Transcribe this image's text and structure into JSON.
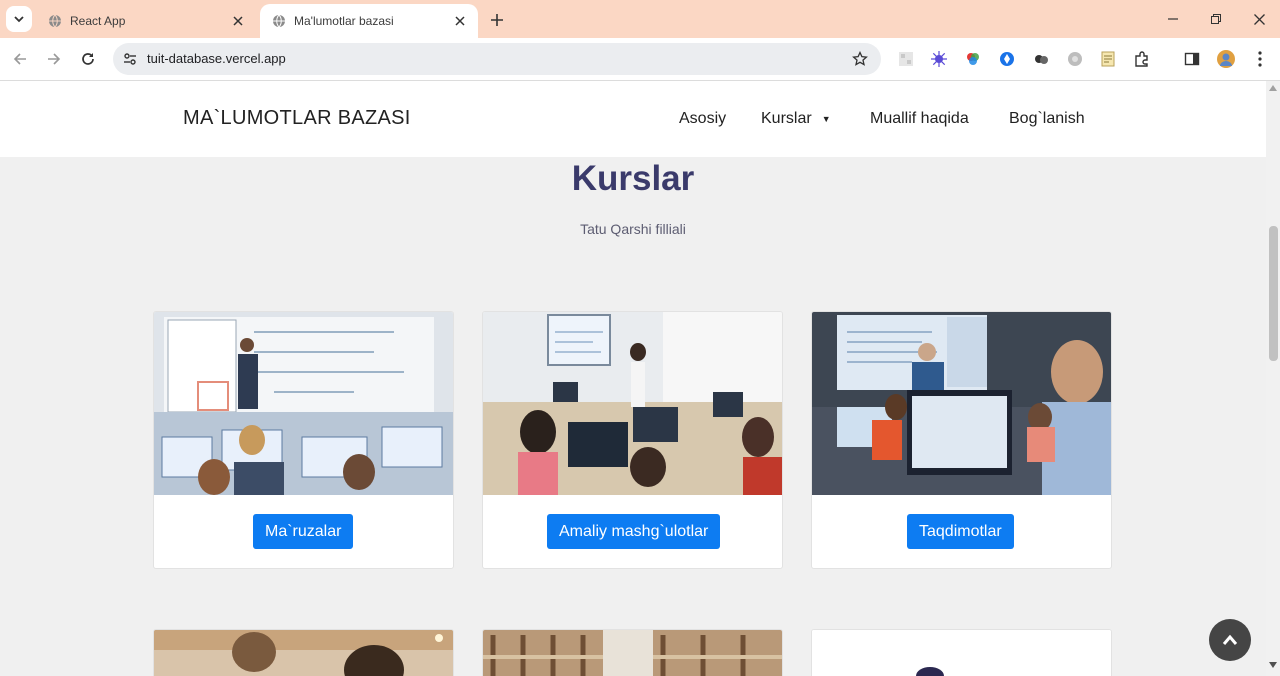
{
  "browser": {
    "tabs": [
      {
        "title": "React App",
        "active": false
      },
      {
        "title": "Ma'lumotlar bazasi",
        "active": true
      }
    ],
    "url": "tuit-database.vercel.app"
  },
  "site": {
    "brand": "MA`LUMOTLAR BAZASI",
    "menu": [
      {
        "label": "Asosiy"
      },
      {
        "label": "Kurslar",
        "has_dropdown": true
      },
      {
        "label": "Muallif haqida"
      },
      {
        "label": "Bog`lanish"
      }
    ]
  },
  "main": {
    "title": "Kurslar",
    "subtitle": "Tatu Qarshi filliali",
    "cards": [
      {
        "button": "Ma`ruzalar",
        "image": "lecture-classroom-photo"
      },
      {
        "button": "Amaliy mashg`ulotlar",
        "image": "computer-lab-photo"
      },
      {
        "button": "Taqdimotlar",
        "image": "presentation-photo"
      }
    ]
  },
  "colors": {
    "tab_strip": "#fbd7c4",
    "heading": "#3a3a6b",
    "button": "#0d7cf2",
    "back_to_top": "#454545"
  }
}
